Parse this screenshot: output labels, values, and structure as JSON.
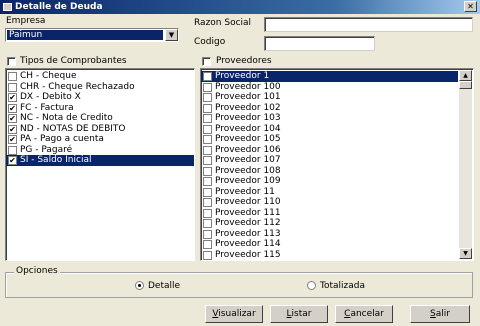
{
  "window": {
    "title": "Detalle de Deuda"
  },
  "empresa": {
    "label": "Empresa",
    "selected": "Paimun"
  },
  "razon_social": {
    "label": "Razon Social",
    "value": ""
  },
  "codigo": {
    "label": "Codigo",
    "value": ""
  },
  "tipos": {
    "label": "Tipos de Comprobantes",
    "checked": false,
    "items": [
      {
        "label": "CH - Cheque",
        "checked": false,
        "selected": false
      },
      {
        "label": "CHR - Cheque Rechazado",
        "checked": false,
        "selected": false
      },
      {
        "label": "DX - Debito X",
        "checked": true,
        "selected": false
      },
      {
        "label": "FC - Factura",
        "checked": true,
        "selected": false
      },
      {
        "label": "NC - Nota de Credito",
        "checked": true,
        "selected": false
      },
      {
        "label": "ND - NOTAS DE DEBITO",
        "checked": true,
        "selected": false
      },
      {
        "label": "PA - Pago a cuenta",
        "checked": true,
        "selected": false
      },
      {
        "label": "PG - Pagaré",
        "checked": false,
        "selected": false
      },
      {
        "label": "SI - Saldo Inicial",
        "checked": true,
        "selected": true
      }
    ]
  },
  "proveedores": {
    "label": "Proveedores",
    "checked": false,
    "items": [
      {
        "label": "Proveedor 1",
        "checked": false,
        "selected": true
      },
      {
        "label": "Proveedor 100",
        "checked": false,
        "selected": false
      },
      {
        "label": "Proveedor 101",
        "checked": false,
        "selected": false
      },
      {
        "label": "Proveedor 102",
        "checked": false,
        "selected": false
      },
      {
        "label": "Proveedor 103",
        "checked": false,
        "selected": false
      },
      {
        "label": "Proveedor 104",
        "checked": false,
        "selected": false
      },
      {
        "label": "Proveedor 105",
        "checked": false,
        "selected": false
      },
      {
        "label": "Proveedor 106",
        "checked": false,
        "selected": false
      },
      {
        "label": "Proveedor 107",
        "checked": false,
        "selected": false
      },
      {
        "label": "Proveedor 108",
        "checked": false,
        "selected": false
      },
      {
        "label": "Proveedor 109",
        "checked": false,
        "selected": false
      },
      {
        "label": "Proveedor 11",
        "checked": false,
        "selected": false
      },
      {
        "label": "Proveedor 110",
        "checked": false,
        "selected": false
      },
      {
        "label": "Proveedor 111",
        "checked": false,
        "selected": false
      },
      {
        "label": "Proveedor 112",
        "checked": false,
        "selected": false
      },
      {
        "label": "Proveedor 113",
        "checked": false,
        "selected": false
      },
      {
        "label": "Proveedor 114",
        "checked": false,
        "selected": false
      },
      {
        "label": "Proveedor 115",
        "checked": false,
        "selected": false
      }
    ]
  },
  "opciones": {
    "label": "Opciones",
    "detalle": {
      "label": "Detalle",
      "checked": true
    },
    "totalizada": {
      "label": "Totalizada",
      "checked": false
    }
  },
  "buttons": {
    "visualizar": {
      "first": "V",
      "rest": "isualizar"
    },
    "listar": {
      "first": "L",
      "rest": "istar"
    },
    "cancelar": {
      "first": "C",
      "rest": "ancelar"
    },
    "salir": {
      "first": "S",
      "rest": "alir"
    }
  },
  "icons": {
    "close": "close-icon",
    "dropdown": "chevron-down-icon",
    "scroll_up": "arrow-up-icon",
    "scroll_down": "arrow-down-icon"
  },
  "colors": {
    "selection": "#0a246a",
    "title_bar": "#0a246a",
    "face": "#ece9d8"
  }
}
